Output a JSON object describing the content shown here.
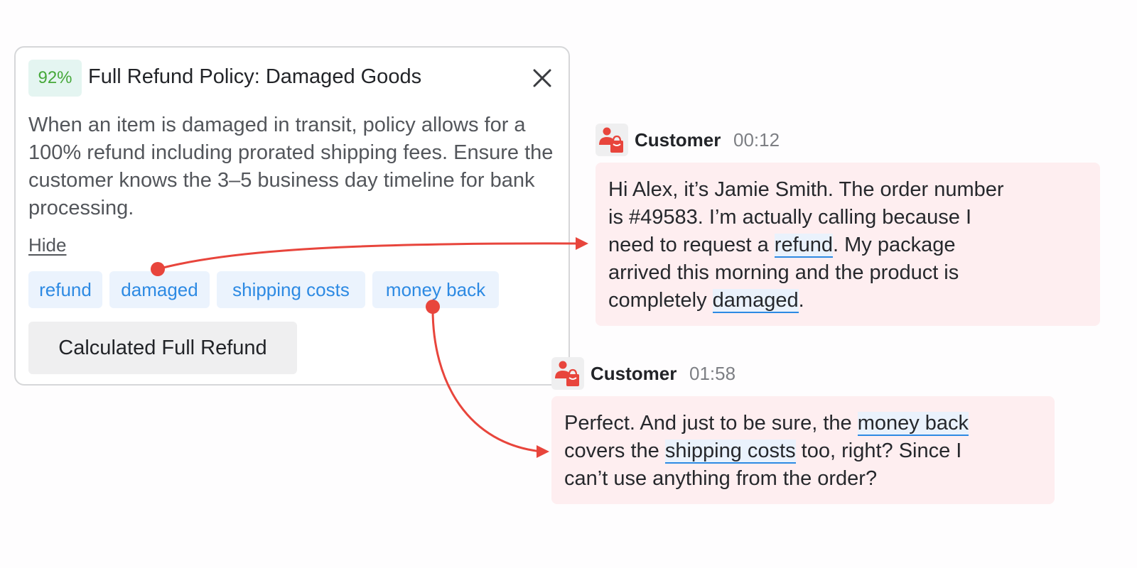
{
  "card": {
    "confidence": "92%",
    "title": "Full Refund Policy: Damaged Goods",
    "description": "When an item is damaged in transit, policy allows for a 100% refund including prorated shipping fees. Ensure the customer knows the 3–5 business day timeline for bank processing.",
    "hide_label": "Hide",
    "tags": [
      "refund",
      "damaged",
      "shipping costs",
      "money back"
    ],
    "action_label": "Calculated Full Refund"
  },
  "messages": [
    {
      "speaker": "Customer",
      "time": "00:12",
      "lines": [
        [
          "Hi Alex, it’s Jamie Smith. The order number"
        ],
        [
          "is #49583. I’m actually calling because I"
        ],
        [
          "need to request a ",
          "refund",
          ". My package"
        ],
        [
          "arrived this morning and the product is"
        ],
        [
          "completely ",
          "damaged",
          "."
        ]
      ]
    },
    {
      "speaker": "Customer",
      "time": "01:58",
      "lines": [
        [
          "Perfect. And just to be sure, the ",
          "money back"
        ],
        [
          "covers the ",
          "shipping costs",
          " too, right? Since I"
        ],
        [
          "can’t use anything from the order?"
        ]
      ]
    }
  ],
  "colors": {
    "accent_blue": "#2d8ae3",
    "arrow_red": "#e8453c",
    "badge_green": "#46a83a",
    "bubble_pink": "#feeef0"
  },
  "icons": {
    "close": "close-icon",
    "avatar": "customer-shopping-bag-icon"
  }
}
